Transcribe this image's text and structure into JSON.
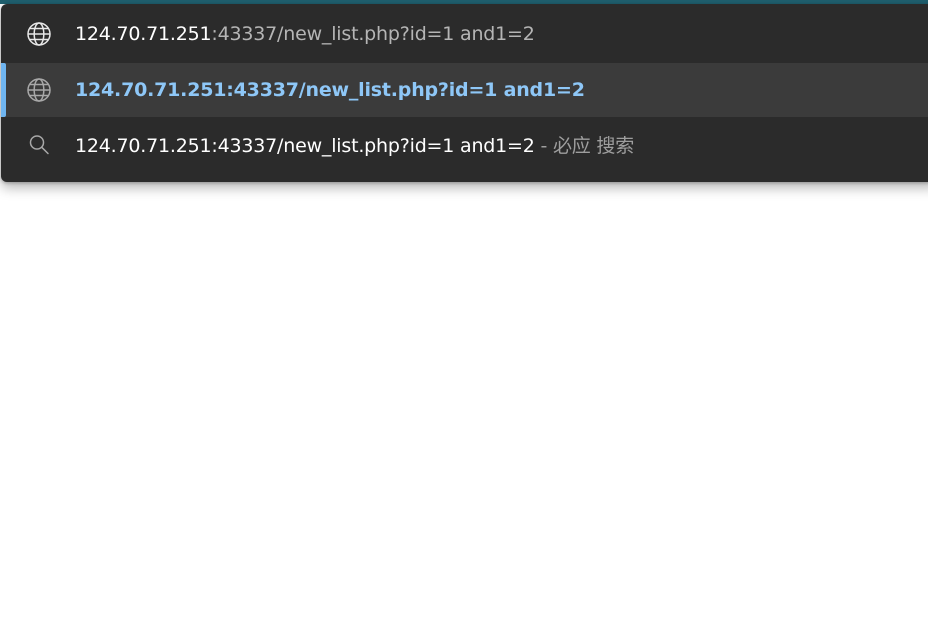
{
  "address_bar": {
    "host": "124.70.71.251",
    "path": ":43337/new_list.php?id=1 and1=2"
  },
  "suggestions": [
    {
      "type": "url",
      "icon": "globe-icon",
      "text": "124.70.71.251:43337/new_list.php?id=1 and1=2",
      "selected": true
    },
    {
      "type": "search",
      "icon": "search-icon",
      "query": "124.70.71.251:43337/new_list.php?id=1 and1=2",
      "engine_suffix": " - 必应 搜索"
    }
  ],
  "colors": {
    "dropdown_bg": "#2b2b2b",
    "selected_bg": "#3b3b3b",
    "accent": "#6fb5f0",
    "selected_text": "#8ec7f7"
  }
}
